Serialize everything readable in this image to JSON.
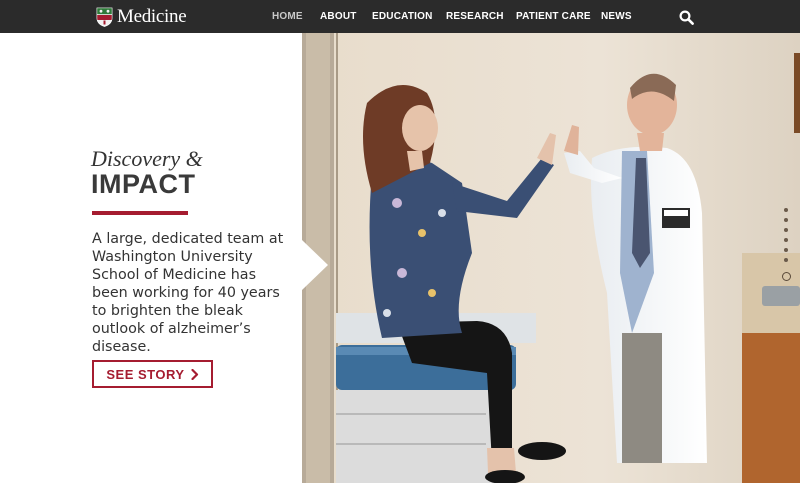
{
  "nav": {
    "brand": "Medicine",
    "items": [
      {
        "label": "HOME",
        "active": true
      },
      {
        "label": "ABOUT",
        "active": false
      },
      {
        "label": "EDUCATION",
        "active": false
      },
      {
        "label": "RESEARCH",
        "active": false
      },
      {
        "label": "PATIENT CARE",
        "active": false
      },
      {
        "label": "NEWS",
        "active": false
      }
    ],
    "search_icon": "search-icon"
  },
  "feature": {
    "kicker": "Discovery &",
    "headline": "IMPACT",
    "body": "A large, dedicated team at Washington University School of Medicine has been working for 40 years to brighten the bleak outlook of alzheimer’s disease.",
    "cta_label": "SEE STORY",
    "cta_icon": "chevron-right-icon"
  },
  "carousel": {
    "slide_count": 7,
    "active_slide": 7
  },
  "colors": {
    "nav_bg": "#2b2b2b",
    "accent": "#a51c30",
    "text": "#333333"
  }
}
